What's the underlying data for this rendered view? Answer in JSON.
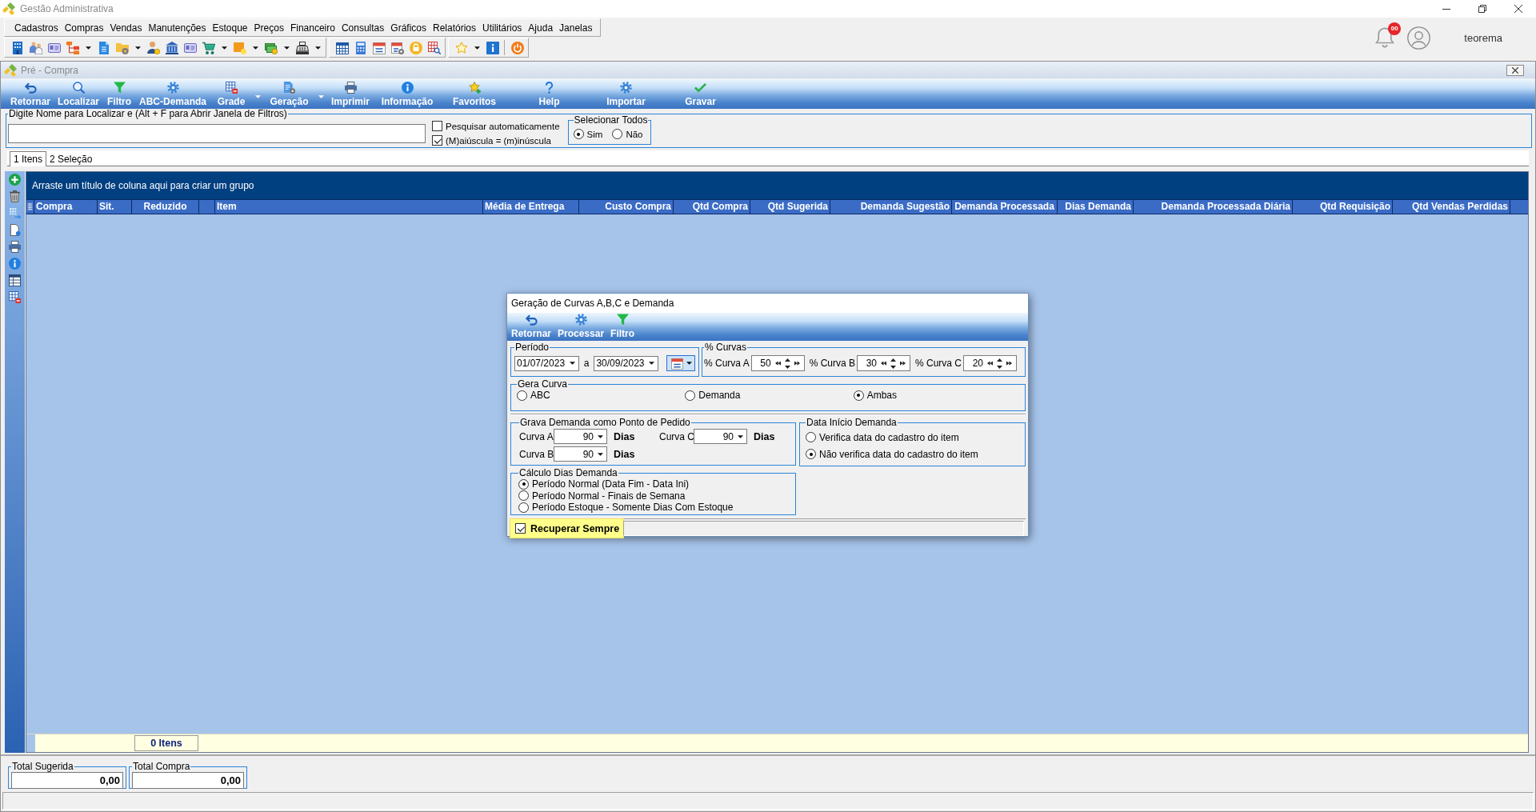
{
  "window": {
    "title": "Gestão Administrativa"
  },
  "menu": [
    "Cadastros",
    "Compras",
    "Vendas",
    "Manutenções",
    "Estoque",
    "Preços",
    "Financeiro",
    "Consultas",
    "Gráficos",
    "Relatórios",
    "Utilitários",
    "Ajuda",
    "Janelas"
  ],
  "user": {
    "notifications": "00",
    "name": "teorema"
  },
  "child_window": {
    "title": "Pré - Compra",
    "toolbar": [
      {
        "label": "Retornar",
        "has_menu": false
      },
      {
        "label": "Localizar",
        "has_menu": false
      },
      {
        "label": "Filtro",
        "has_menu": false
      },
      {
        "label": "ABC-Demanda",
        "has_menu": false
      },
      {
        "label": "Grade",
        "has_menu": true
      },
      {
        "label": "Geração",
        "has_menu": true
      },
      {
        "label": "Imprimir",
        "has_menu": false
      },
      {
        "label": "Informação",
        "has_menu": false
      },
      {
        "label": "Favoritos",
        "has_menu": false
      },
      {
        "label": "Help",
        "has_menu": false
      },
      {
        "label": "Importar",
        "has_menu": false
      },
      {
        "label": "Gravar",
        "has_menu": false
      }
    ],
    "search": {
      "legend": "Digite Nome para Localizar e (Alt + F para Abrir Janela de Filtros)",
      "options": [
        {
          "label": "Pesquisar automaticamente",
          "checked": false
        },
        {
          "label": "(M)aiúscula = (m)inúscula",
          "checked": true
        }
      ],
      "select_all": {
        "legend": "Selecionar Todos",
        "options": [
          {
            "label": "Sim",
            "selected": true
          },
          {
            "label": "Não",
            "selected": false
          }
        ]
      }
    },
    "tabs": [
      {
        "label": "1 Itens",
        "selected": true
      },
      {
        "label": "2 Seleção",
        "selected": false
      }
    ],
    "grid": {
      "group_panel": "Arraste um título de coluna aqui para criar um grupo",
      "columns": [
        "Compra",
        "Sit.",
        "Reduzido",
        "Item",
        "Média de Entrega",
        "Custo Compra",
        "Qtd Compra",
        "Qtd Sugerida",
        "Demanda Sugestão",
        "Demanda Processada",
        "Dias Demanda",
        "Demanda Processada Diária",
        "Qtd Requisição",
        "Qtd Vendas Perdidas"
      ],
      "footer": "0 Itens"
    },
    "totals": [
      {
        "label": "Total Sugerida",
        "value": "0,00"
      },
      {
        "label": "Total Compra",
        "value": "0,00"
      }
    ]
  },
  "dialog": {
    "title": "Geração de Curvas A,B,C e Demanda",
    "toolbar": [
      "Retornar",
      "Processar",
      "Filtro"
    ],
    "period": {
      "legend": "Período",
      "from": "01/07/2023",
      "separator": "a",
      "to": "30/09/2023"
    },
    "curves": {
      "legend": "% Curvas",
      "fields": [
        {
          "label": "% Curva A",
          "value": "50"
        },
        {
          "label": "% Curva B",
          "value": "30"
        },
        {
          "label": "% Curva C",
          "value": "20"
        }
      ]
    },
    "generate": {
      "legend": "Gera Curva",
      "options": [
        {
          "label": "ABC",
          "selected": false
        },
        {
          "label": "Demanda",
          "selected": false
        },
        {
          "label": "Ambas",
          "selected": true
        }
      ]
    },
    "order_point": {
      "legend": "Grava Demanda como Ponto de Pedido",
      "fields": [
        {
          "label": "Curva A",
          "value": "90",
          "unit": "Dias"
        },
        {
          "label": "Curva C",
          "value": "90",
          "unit": "Dias"
        },
        {
          "label": "Curva B",
          "value": "90",
          "unit": "Dias"
        }
      ]
    },
    "start_date": {
      "legend": "Data Início Demanda",
      "options": [
        {
          "label": "Verifica data do cadastro do item",
          "selected": false
        },
        {
          "label": "Não verifica data do cadastro do item",
          "selected": true
        }
      ]
    },
    "days_calc": {
      "legend": "Cálculo Dias Demanda",
      "options": [
        {
          "label": "Período Normal (Data Fim - Data Ini)",
          "selected": true
        },
        {
          "label": "Período Normal - Finais de Semana",
          "selected": false
        },
        {
          "label": "Período Estoque - Somente Dias Com Estoque",
          "selected": false
        }
      ]
    },
    "recover": {
      "label": "Recuperar Sempre",
      "checked": true,
      "focused": true
    }
  }
}
